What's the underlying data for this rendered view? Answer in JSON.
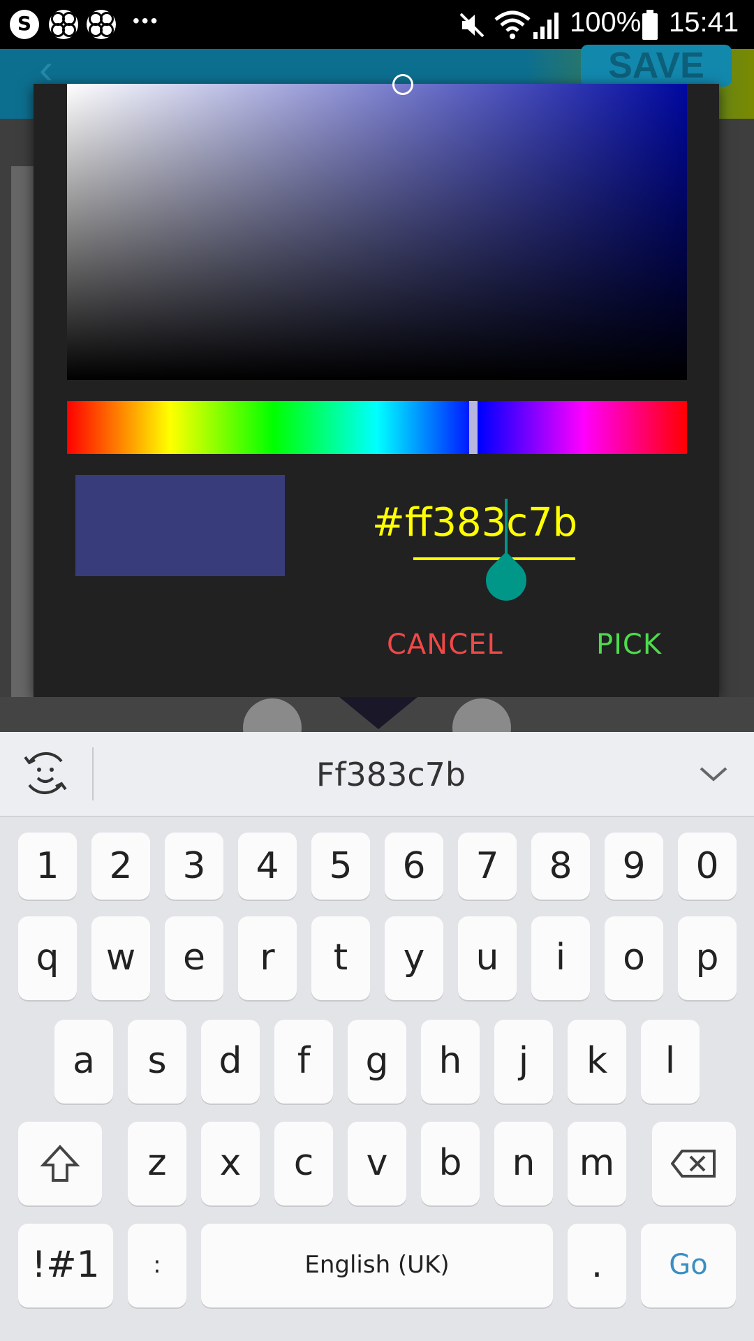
{
  "status_bar": {
    "icons": [
      "skype-icon",
      "clover-icon",
      "clover-icon",
      "more-dots-icon"
    ],
    "mute_icon": "mute-icon",
    "wifi_icon": "wifi-icon",
    "signal_icon": "signal-icon",
    "battery_percent": "100%",
    "battery_icon": "battery-icon",
    "time": "15:41"
  },
  "background_app": {
    "save_label": "SAVE"
  },
  "color_picker": {
    "selected_color": "#383c7b",
    "hex_value": "#ff383c7b",
    "cancel_label": "CANCEL",
    "pick_label": "PICK",
    "accent_cancel": "#f04848",
    "accent_pick": "#4cdc4c",
    "hex_color": "#ffff00"
  },
  "keyboard": {
    "suggestion": "Ff383c7b",
    "number_row": [
      "1",
      "2",
      "3",
      "4",
      "5",
      "6",
      "7",
      "8",
      "9",
      "0"
    ],
    "row1": [
      "q",
      "w",
      "e",
      "r",
      "t",
      "y",
      "u",
      "i",
      "o",
      "p"
    ],
    "row2": [
      "a",
      "s",
      "d",
      "f",
      "g",
      "h",
      "j",
      "k",
      "l"
    ],
    "row3": [
      "z",
      "x",
      "c",
      "v",
      "b",
      "n",
      "m"
    ],
    "symbols_label": "!#1",
    "colon_label": ":",
    "space_label": "English (UK)",
    "period_label": ".",
    "go_label": "Go"
  }
}
